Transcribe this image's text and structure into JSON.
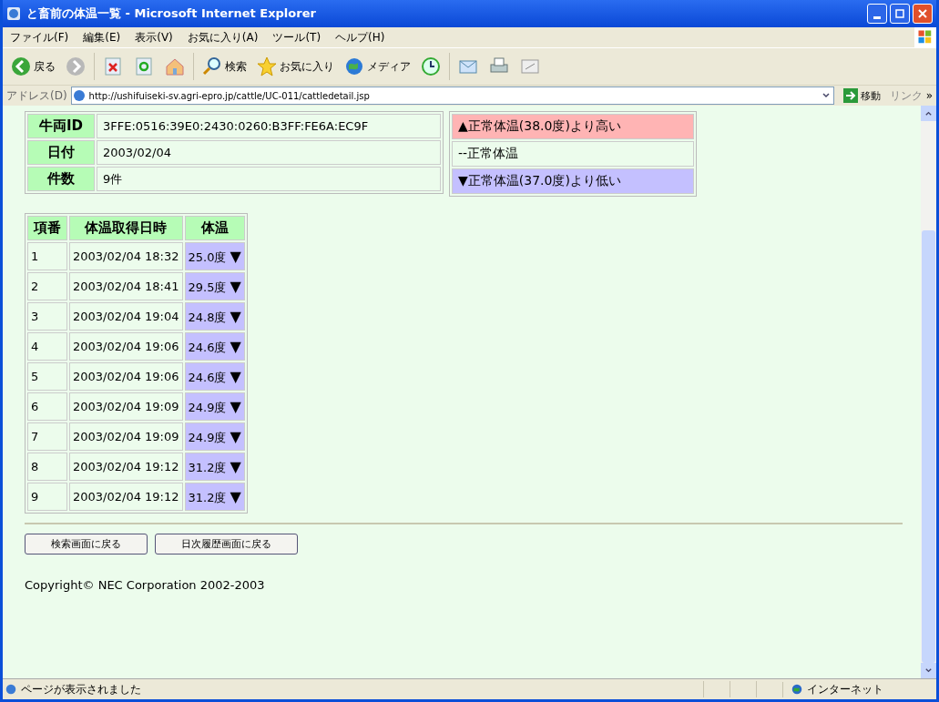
{
  "window": {
    "title": "と畜前の体温一覧 - Microsoft Internet Explorer"
  },
  "menu": [
    "ファイル(F)",
    "編集(E)",
    "表示(V)",
    "お気に入り(A)",
    "ツール(T)",
    "ヘルプ(H)"
  ],
  "toolbar": [
    {
      "kind": "back",
      "label": "戻る"
    },
    {
      "kind": "forward"
    },
    {
      "kind": "stop"
    },
    {
      "kind": "refresh"
    },
    {
      "kind": "home"
    },
    {
      "kind": "search",
      "label": "検索"
    },
    {
      "kind": "favorites",
      "label": "お気に入り"
    },
    {
      "kind": "media",
      "label": "メディア"
    },
    {
      "kind": "history"
    },
    {
      "kind": "mail"
    },
    {
      "kind": "print"
    },
    {
      "kind": "edit"
    }
  ],
  "address": {
    "label": "アドレス(D)",
    "value": "http://ushifuiseki-sv.agri-epro.jp/cattle/UC-011/cattledetail.jsp",
    "go": "移動",
    "links": "リンク",
    "more": "»"
  },
  "info": [
    {
      "label": "牛両ID",
      "value": "3FFE:0516:39E0:2430:0260:B3FF:FE6A:EC9F"
    },
    {
      "label": "日付",
      "value": "2003/02/04"
    },
    {
      "label": "件数",
      "value": "9件"
    }
  ],
  "legend": [
    {
      "text": "▲正常体温(38.0度)より高い",
      "color": "#ffb4b4"
    },
    {
      "text": "--正常体温",
      "color": "#ecfcec"
    },
    {
      "text": "▼正常体温(37.0度)より低い",
      "color": "#c4c0ff"
    }
  ],
  "table": {
    "columns": [
      "項番",
      "体温取得日時",
      "体温"
    ],
    "rows": [
      {
        "no": "1",
        "time": "2003/02/04 18:32",
        "temp": "25.0度",
        "mark": "▼",
        "color": "#c4c0ff"
      },
      {
        "no": "2",
        "time": "2003/02/04 18:41",
        "temp": "29.5度",
        "mark": "▼",
        "color": "#c4c0ff"
      },
      {
        "no": "3",
        "time": "2003/02/04 19:04",
        "temp": "24.8度",
        "mark": "▼",
        "color": "#c4c0ff"
      },
      {
        "no": "4",
        "time": "2003/02/04 19:06",
        "temp": "24.6度",
        "mark": "▼",
        "color": "#c4c0ff"
      },
      {
        "no": "5",
        "time": "2003/02/04 19:06",
        "temp": "24.6度",
        "mark": "▼",
        "color": "#c4c0ff"
      },
      {
        "no": "6",
        "time": "2003/02/04 19:09",
        "temp": "24.9度",
        "mark": "▼",
        "color": "#c4c0ff"
      },
      {
        "no": "7",
        "time": "2003/02/04 19:09",
        "temp": "24.9度",
        "mark": "▼",
        "color": "#c4c0ff"
      },
      {
        "no": "8",
        "time": "2003/02/04 19:12",
        "temp": "31.2度",
        "mark": "▼",
        "color": "#c4c0ff"
      },
      {
        "no": "9",
        "time": "2003/02/04 19:12",
        "temp": "31.2度",
        "mark": "▼",
        "color": "#c4c0ff"
      }
    ]
  },
  "buttons": [
    "検索画面に戻る",
    "日次履歴画面に戻る"
  ],
  "copyright": "Copyright© NEC Corporation 2002-2003",
  "status_bar": {
    "text": "ページが表示されました",
    "zone": "インターネット"
  }
}
